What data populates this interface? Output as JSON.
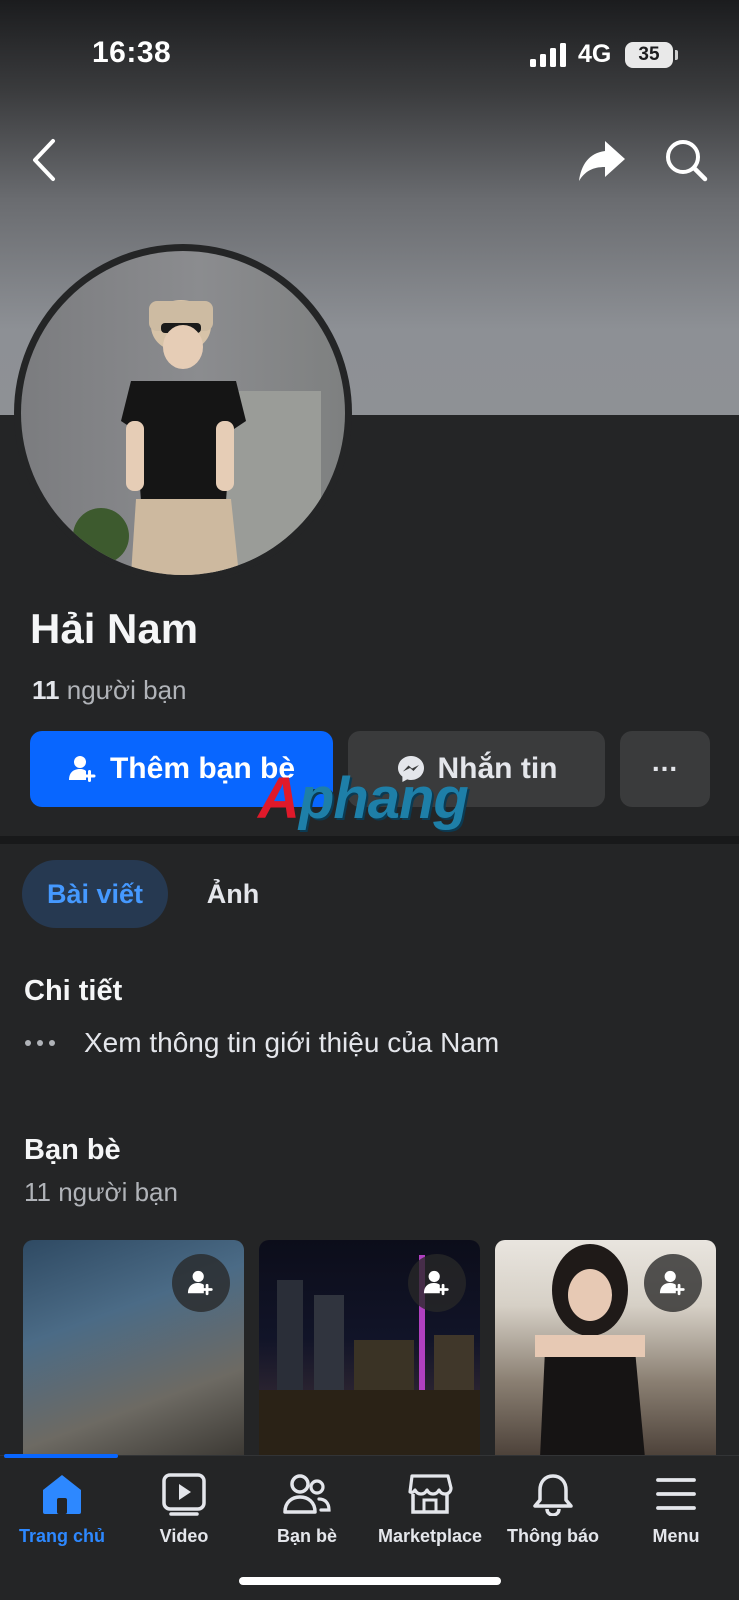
{
  "status_bar": {
    "time": "16:38",
    "network": "4G",
    "battery": "35"
  },
  "profile": {
    "name": "Hải Nam",
    "friend_count_number": "11",
    "friend_count_label": "người bạn"
  },
  "actions": {
    "add_friend_label": "Thêm bạn bè",
    "message_label": "Nhắn tin",
    "more_label": "..."
  },
  "watermark": {
    "first": "A",
    "rest": "phang"
  },
  "tabs": [
    {
      "label": "Bài viết",
      "active": true
    },
    {
      "label": "Ảnh",
      "active": false
    }
  ],
  "details": {
    "title": "Chi tiết",
    "intro_link": "Xem thông tin giới thiệu của Nam"
  },
  "friends": {
    "title": "Bạn bè",
    "subtitle": "11 người bạn"
  },
  "bottom_nav": [
    {
      "label": "Trang chủ",
      "icon": "home-icon",
      "active": true
    },
    {
      "label": "Video",
      "icon": "video-icon",
      "active": false
    },
    {
      "label": "Bạn bè",
      "icon": "friends-icon",
      "active": false
    },
    {
      "label": "Marketplace",
      "icon": "marketplace-icon",
      "active": false
    },
    {
      "label": "Thông báo",
      "icon": "bell-icon",
      "active": false
    },
    {
      "label": "Menu",
      "icon": "menu-icon",
      "active": false
    }
  ],
  "colors": {
    "accent": "#0866ff",
    "background": "#242526",
    "button_secondary": "#3a3b3c"
  }
}
